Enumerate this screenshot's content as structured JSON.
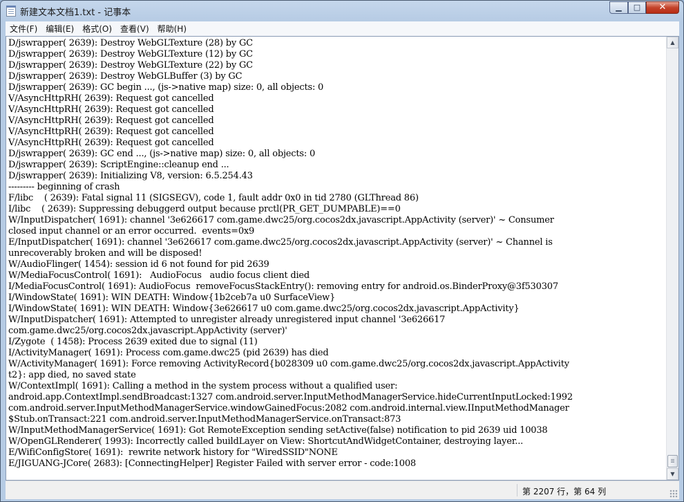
{
  "window": {
    "title": "新建文本文档1.txt - 记事本",
    "controls": {
      "minimize": "▁",
      "maximize": "□",
      "close": "✕"
    }
  },
  "menu": [
    "文件(F)",
    "编辑(E)",
    "格式(O)",
    "查看(V)",
    "帮助(H)"
  ],
  "editor": {
    "lines": [
      "D/jswrapper( 2639): Destroy WebGLTexture (28) by GC",
      "D/jswrapper( 2639): Destroy WebGLTexture (12) by GC",
      "D/jswrapper( 2639): Destroy WebGLTexture (22) by GC",
      "D/jswrapper( 2639): Destroy WebGLBuffer (3) by GC",
      "D/jswrapper( 2639): GC begin ..., (js->native map) size: 0, all objects: 0",
      "V/AsyncHttpRH( 2639): Request got cancelled",
      "V/AsyncHttpRH( 2639): Request got cancelled",
      "V/AsyncHttpRH( 2639): Request got cancelled",
      "V/AsyncHttpRH( 2639): Request got cancelled",
      "V/AsyncHttpRH( 2639): Request got cancelled",
      "D/jswrapper( 2639): GC end ..., (js->native map) size: 0, all objects: 0",
      "D/jswrapper( 2639): ScriptEngine::cleanup end ...",
      "D/jswrapper( 2639): Initializing V8, version: 6.5.254.43",
      "--------- beginning of crash",
      "F/libc    ( 2639): Fatal signal 11 (SIGSEGV), code 1, fault addr 0x0 in tid 2780 (GLThread 86)",
      "I/libc    ( 2639): Suppressing debuggerd output because prctl(PR_GET_DUMPABLE)==0",
      "W/InputDispatcher( 1691): channel '3e626617 com.game.dwc25/org.cocos2dx.javascript.AppActivity (server)' ~ Consumer",
      "closed input channel or an error occurred.  events=0x9",
      "E/InputDispatcher( 1691): channel '3e626617 com.game.dwc25/org.cocos2dx.javascript.AppActivity (server)' ~ Channel is",
      "unrecoverably broken and will be disposed!",
      "W/AudioFlinger( 1454): session id 6 not found for pid 2639",
      "W/MediaFocusControl( 1691):   AudioFocus   audio focus client died",
      "I/MediaFocusControl( 1691): AudioFocus  removeFocusStackEntry(): removing entry for android.os.BinderProxy@3f530307",
      "I/WindowState( 1691): WIN DEATH: Window{1b2ceb7a u0 SurfaceView}",
      "I/WindowState( 1691): WIN DEATH: Window{3e626617 u0 com.game.dwc25/org.cocos2dx.javascript.AppActivity}",
      "W/InputDispatcher( 1691): Attempted to unregister already unregistered input channel '3e626617",
      "com.game.dwc25/org.cocos2dx.javascript.AppActivity (server)'",
      "I/Zygote  ( 1458): Process 2639 exited due to signal (11)",
      "I/ActivityManager( 1691): Process com.game.dwc25 (pid 2639) has died",
      "W/ActivityManager( 1691): Force removing ActivityRecord{b028309 u0 com.game.dwc25/org.cocos2dx.javascript.AppActivity",
      "t2}: app died, no saved state",
      "W/ContextImpl( 1691): Calling a method in the system process without a qualified user:",
      "android.app.ContextImpl.sendBroadcast:1327 com.android.server.InputMethodManagerService.hideCurrentInputLocked:1992",
      "com.android.server.InputMethodManagerService.windowGainedFocus:2082 com.android.internal.view.IInputMethodManager",
      "$Stub.onTransact:221 com.android.server.InputMethodManagerService.onTransact:873",
      "W/InputMethodManagerService( 1691): Got RemoteException sending setActive(false) notification to pid 2639 uid 10038",
      "W/OpenGLRenderer( 1993): Incorrectly called buildLayer on View: ShortcutAndWidgetContainer, destroying layer...",
      "E/WifiConfigStore( 1691):  rewrite network history for \"WiredSSID\"NONE",
      "E/JIGUANG-JCore( 2683): [ConnectingHelper] Register Failed with server error - code:1008"
    ]
  },
  "statusbar": {
    "position": "第 2207 行，第 64 列"
  }
}
